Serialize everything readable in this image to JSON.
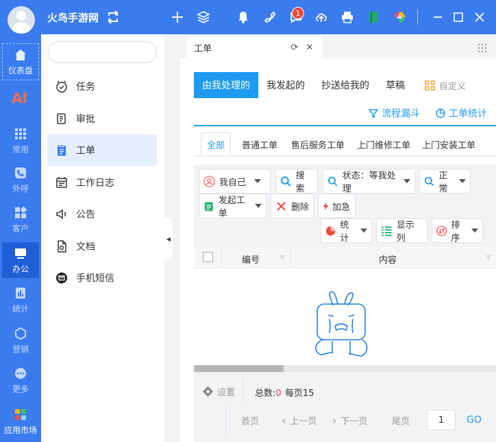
{
  "app": {
    "title": "火鸟手游网"
  },
  "notifications": {
    "badge_count": "1"
  },
  "leftnav": {
    "items": [
      {
        "label": "仪表盘",
        "icon": "home-icon"
      },
      {
        "label": "常用",
        "icon": "grid-icon"
      },
      {
        "label": "外呼",
        "icon": "phone-icon"
      },
      {
        "label": "客户",
        "icon": "blocks-icon"
      },
      {
        "label": "办公",
        "icon": "monitor-icon"
      },
      {
        "label": "统计",
        "icon": "bar-chart-icon"
      },
      {
        "label": "营销",
        "icon": "hexagon-icon"
      },
      {
        "label": "更多",
        "icon": "more-icon"
      },
      {
        "label": "应用市场",
        "icon": "app-market-icon"
      }
    ],
    "ai_label": "AI"
  },
  "subnav": {
    "items": [
      {
        "label": "任务"
      },
      {
        "label": "审批"
      },
      {
        "label": "工单"
      },
      {
        "label": "工作日志"
      },
      {
        "label": "公告"
      },
      {
        "label": "文档"
      },
      {
        "label": "手机短信"
      }
    ]
  },
  "tabbar": {
    "active_tab": "工单"
  },
  "primary_tabs": [
    {
      "label": "由我处理的"
    },
    {
      "label": "我发起的"
    },
    {
      "label": "抄送给我的"
    },
    {
      "label": "草稿"
    }
  ],
  "custom_label": "自定义",
  "links": {
    "funnel": "流程漏斗",
    "stats": "工单统计"
  },
  "sub_tabs": [
    {
      "label": "全部"
    },
    {
      "label": "普通工单"
    },
    {
      "label": "售后服务工单"
    },
    {
      "label": "上门维修工单"
    },
    {
      "label": "上门安装工单"
    }
  ],
  "toolbar": {
    "self": "我自己",
    "search": "搜索",
    "status": "状态：等我处理",
    "normal": "正常",
    "create": "发起工单",
    "delete": "删除",
    "urgent": "加急",
    "stats": "统计",
    "columns": "显示列",
    "sort": "排序"
  },
  "table": {
    "columns": [
      "编号",
      "内容"
    ]
  },
  "footer": {
    "settings": "设置",
    "total_label": "总数:",
    "total_value": "0",
    "per_page_label": "每页",
    "per_page_value": "15",
    "first": "首页",
    "prev": "上一页",
    "next": "下一页",
    "last": "尾页",
    "page_input": "1",
    "go": "GO"
  },
  "colors": {
    "accent": "#3a7cf0",
    "tab_blue": "#1d9bf0",
    "badge": "#f5483b",
    "ai": "#ff6b4a"
  }
}
